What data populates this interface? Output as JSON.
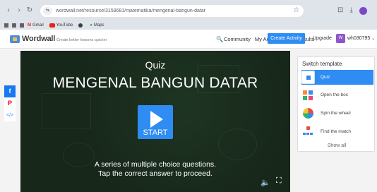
{
  "browser": {
    "nav": {
      "back": "‹",
      "forward": "›",
      "reload": "↻"
    },
    "url": "wordwall.net/resource/3158681/matematika/mengenal-bangun-datar",
    "site_icon": "⇆",
    "star": "☆",
    "right_icons": {
      "tab_search": "⊡",
      "download": "⤓"
    },
    "bookmarks": [
      {
        "label": "Gmail",
        "icon": "gmail-icon"
      },
      {
        "label": "YouTube",
        "icon": "youtube-icon"
      },
      {
        "label": "",
        "icon": "globe-icon"
      },
      {
        "label": "Maps",
        "icon": "maps-icon"
      }
    ]
  },
  "header": {
    "logo": "Wordwall",
    "tagline": "Create better lessons quicker",
    "links": {
      "search_icon": "🔍",
      "community": "Community",
      "my_activities": "My Activities",
      "my_results": "My Results"
    },
    "create_activity": "Create Activity",
    "upgrade": "Upgrade",
    "user": {
      "initials": "W",
      "name": "wh030795",
      "chevron": "⌄"
    }
  },
  "share": {
    "facebook": "f",
    "pinterest": "P",
    "embed": "</>"
  },
  "game": {
    "type": "Quiz",
    "title": "MENGENAL BANGUN DATAR",
    "start_label": "START",
    "description_line1": "A series of multiple choice questions.",
    "description_line2": "Tap the correct answer to proceed.",
    "sound_icon": "🔈",
    "fullscreen_icon": "⛶"
  },
  "switch_template": {
    "title": "Switch template",
    "items": [
      {
        "label": "Quiz",
        "active": true
      },
      {
        "label": "Open the box",
        "active": false
      },
      {
        "label": "Spin the wheel",
        "active": false
      },
      {
        "label": "Find the match",
        "active": false
      }
    ],
    "show_all": "Show all"
  },
  "colors": {
    "accent": "#2e8cf2",
    "game_bg": "#17271a",
    "browser_chrome": "#dfe3ea"
  }
}
